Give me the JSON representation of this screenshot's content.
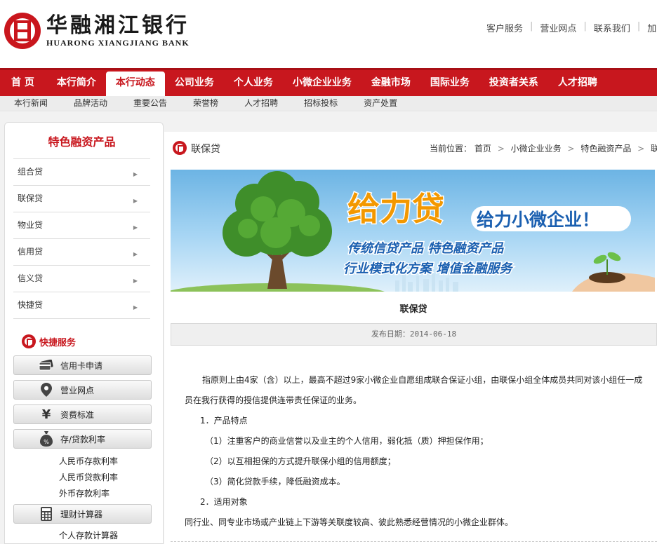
{
  "header": {
    "logo_cn": "华融湘江银行",
    "logo_en": "HUARONG XIANGJIANG BANK",
    "top_links": [
      "客户服务",
      "营业网点",
      "联系我们",
      "加入"
    ]
  },
  "main_nav": {
    "items": [
      "首 页",
      "本行简介",
      "本行动态",
      "公司业务",
      "个人业务",
      "小微企业业务",
      "金融市场",
      "国际业务",
      "投资者关系",
      "人才招聘"
    ],
    "active": "本行动态"
  },
  "sub_nav": {
    "items": [
      "本行新闻",
      "品牌活动",
      "重要公告",
      "荣誉榜",
      "人才招聘",
      "招标投标",
      "资产处置"
    ]
  },
  "sidebar": {
    "title": "特色融资产品",
    "items": [
      "组合贷",
      "联保贷",
      "物业贷",
      "信用贷",
      "信义贷",
      "快捷贷"
    ],
    "arrow": "▶"
  },
  "quick_services": {
    "title": "快捷服务",
    "buttons": [
      {
        "label": "信用卡申请",
        "icon": "credit-card-icon"
      },
      {
        "label": "营业网点",
        "icon": "location-pin-icon"
      },
      {
        "label": "资费标准",
        "icon": "yen-icon"
      },
      {
        "label": "存/贷款利率",
        "icon": "money-bag-icon"
      },
      {
        "label": "理财计算器",
        "icon": "calculator-icon"
      }
    ],
    "rate_links": [
      "人民币存款利率",
      "人民币贷款利率",
      "外币存款利率"
    ],
    "calc_links": [
      "个人存款计算器"
    ]
  },
  "breadcrumb": {
    "page_title": "联保贷",
    "prefix": "当前位置：",
    "path": [
      "首页",
      "小微企业业务",
      "特色融资产品",
      "联保贷"
    ],
    "separator": ">"
  },
  "banner": {
    "headline": "给力贷",
    "slogan": "给力小微企业！",
    "line1": "传统信贷产品  特色融资产品",
    "line2": "行业模式化方案  增值金融服务"
  },
  "article": {
    "title": "联保贷",
    "publish": "发布日期：2014-06-18",
    "intro": "指原则上由4家（含）以上，最高不超过9家小微企业自愿组成联合保证小组，由联保小组全体成员共同对该小组任一成员在我行获得的授信提供连带责任保证的业务。",
    "section1": "1．产品特点",
    "points": [
      "（1）注重客户的商业信誉以及业主的个人信用，弱化抵（质）押担保作用；",
      "（2）以互相担保的方式提升联保小组的信用额度；",
      "（3）简化贷款手续，降低融资成本。"
    ],
    "section2": "2．适用对象",
    "target": "同行业、同专业市场或产业链上下游等关联度较高、彼此熟悉经营情况的小微企业群体。"
  },
  "colors": {
    "brand_red": "#c8171e",
    "nav_bg": "#c8171e",
    "banner_orange": "#f39800",
    "banner_blue": "#1a5fb0"
  }
}
